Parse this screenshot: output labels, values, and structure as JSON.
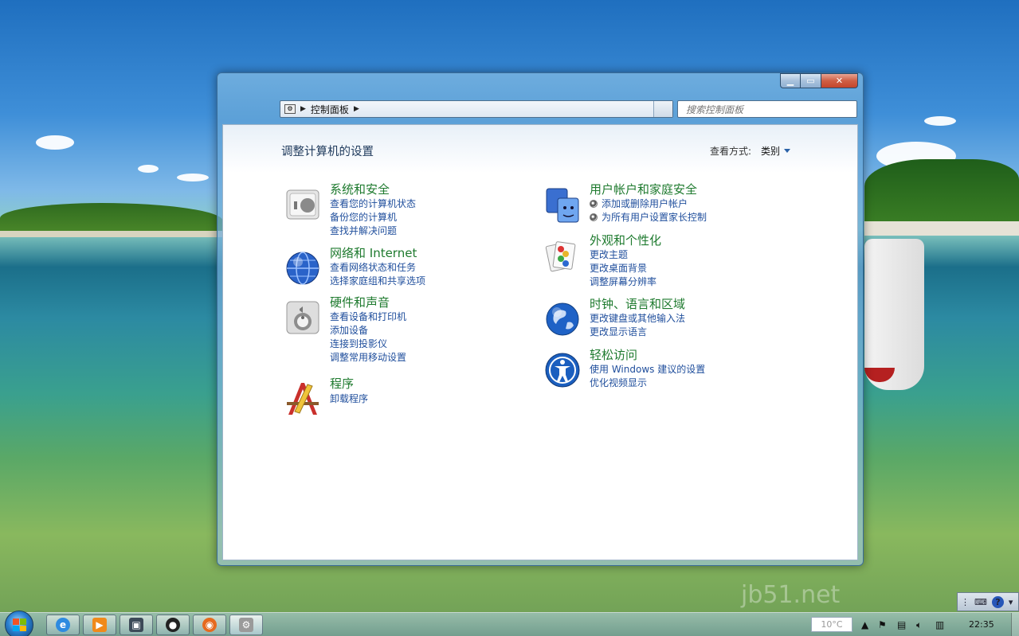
{
  "window": {
    "breadcrumb": "控制面板",
    "search_placeholder": "搜索控制面板",
    "min_icon": "minimize-icon",
    "max_icon": "maximize-icon",
    "close_icon": "close-icon"
  },
  "content": {
    "title": "调整计算机的设置",
    "view_by_label": "查看方式:",
    "view_by_value": "类别"
  },
  "categories": [
    {
      "title": "系统和安全",
      "icon": "system-security-icon",
      "links": [
        "查看您的计算机状态",
        "备份您的计算机",
        "查找并解决问题"
      ]
    },
    {
      "title": "网络和 Internet",
      "icon": "network-icon",
      "links": [
        "查看网络状态和任务",
        "选择家庭组和共享选项"
      ]
    },
    {
      "title": "硬件和声音",
      "icon": "hardware-sound-icon",
      "links": [
        "查看设备和打印机",
        "添加设备",
        "连接到投影仪",
        "调整常用移动设置"
      ]
    },
    {
      "title": "程序",
      "icon": "programs-icon",
      "links": [
        "卸载程序"
      ]
    },
    {
      "title": "用户帐户和家庭安全",
      "icon": "user-accounts-icon",
      "links": [
        "添加或删除用户帐户",
        "为所有用户设置家长控制"
      ]
    },
    {
      "title": "外观和个性化",
      "icon": "appearance-icon",
      "links": [
        "更改主题",
        "更改桌面背景",
        "调整屏幕分辨率"
      ]
    },
    {
      "title": "时钟、语言和区域",
      "icon": "clock-language-icon",
      "links": [
        "更改键盘或其他输入法",
        "更改显示语言"
      ]
    },
    {
      "title": "轻松访问",
      "icon": "ease-of-access-icon",
      "links": [
        "使用 Windows 建议的设置",
        "优化视频显示"
      ]
    }
  ],
  "taskbar": {
    "temperature": "10°C",
    "clock": "22:35",
    "buttons": [
      "internet-explorer-icon",
      "media-player-icon",
      "screen-icon",
      "qq-icon",
      "firefox-icon",
      "control-panel-icon"
    ]
  },
  "watermark": "jb51.net"
}
